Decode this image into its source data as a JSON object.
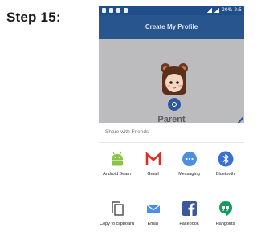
{
  "step_label": "Step 15:",
  "status_bar": {
    "text": "20% 2:5"
  },
  "app_bar": {
    "title": "Create My Profile"
  },
  "profile": {
    "name": "Parent"
  },
  "share_sheet": {
    "title": "Share with Friends",
    "apps": [
      {
        "label": "Android Beam",
        "icon": "android-beam-icon"
      },
      {
        "label": "Gmail",
        "icon": "gmail-icon"
      },
      {
        "label": "Messaging",
        "icon": "messaging-icon"
      },
      {
        "label": "Bluetooth",
        "icon": "bluetooth-icon"
      },
      {
        "label": "Copy to clipboard",
        "icon": "copy-icon"
      },
      {
        "label": "Email",
        "icon": "email-icon"
      },
      {
        "label": "Facebook",
        "icon": "facebook-icon"
      },
      {
        "label": "Hangouts",
        "icon": "hangouts-icon"
      }
    ]
  },
  "colors": {
    "app_bar": "#28558e",
    "accent": "#2b56a0",
    "overlay": "#bcbcbe",
    "android_green": "#8bc34a",
    "gmail_red": "#d93025",
    "facebook_blue": "#3b5998",
    "hangouts_green": "#0f9d58"
  }
}
